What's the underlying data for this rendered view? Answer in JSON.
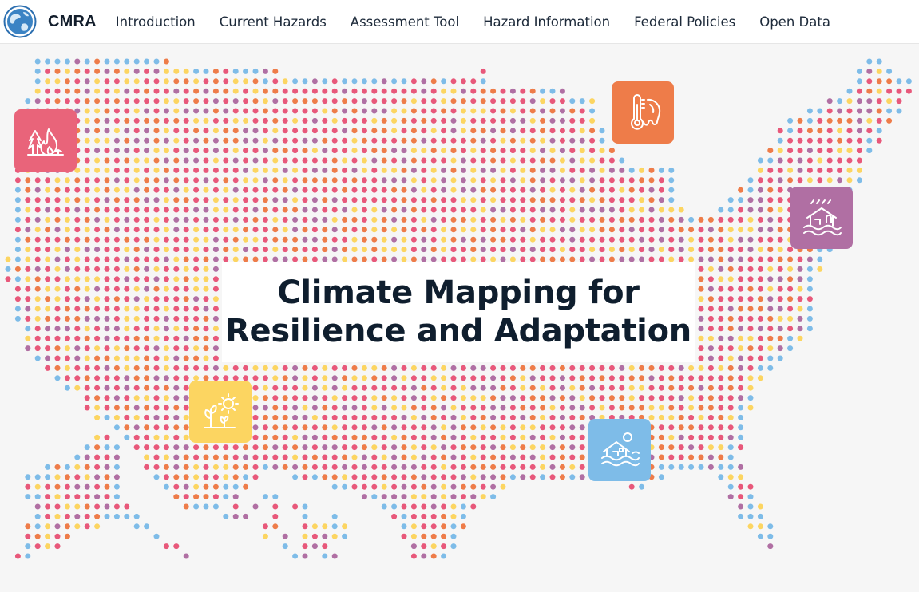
{
  "brand": {
    "name": "CMRA"
  },
  "nav": {
    "items": [
      {
        "label": "Introduction"
      },
      {
        "label": "Current Hazards"
      },
      {
        "label": "Assessment Tool"
      },
      {
        "label": "Hazard Information"
      },
      {
        "label": "Federal Policies"
      },
      {
        "label": "Open Data"
      }
    ]
  },
  "hero": {
    "title_line1": "Climate Mapping for",
    "title_line2": "Resilience and Adaptation"
  },
  "hazards": [
    {
      "name": "wildfire",
      "icon": "wildfire-icon",
      "color": "#e9647a"
    },
    {
      "name": "extreme-heat",
      "icon": "extreme-heat-icon",
      "color": "#ee7c49"
    },
    {
      "name": "inland-flooding",
      "icon": "inland-flooding-icon",
      "color": "#b06fa3"
    },
    {
      "name": "drought",
      "icon": "drought-icon",
      "color": "#fcd561"
    },
    {
      "name": "coastal-flooding",
      "icon": "coastal-flooding-icon",
      "color": "#7ebce8"
    }
  ],
  "colors": {
    "dot_palette": [
      "#e8587a",
      "#b06fa3",
      "#fcd561",
      "#ee7c49",
      "#e8587a"
    ],
    "coast_dot": "#7ebce8",
    "title": "#0f1e2e"
  }
}
